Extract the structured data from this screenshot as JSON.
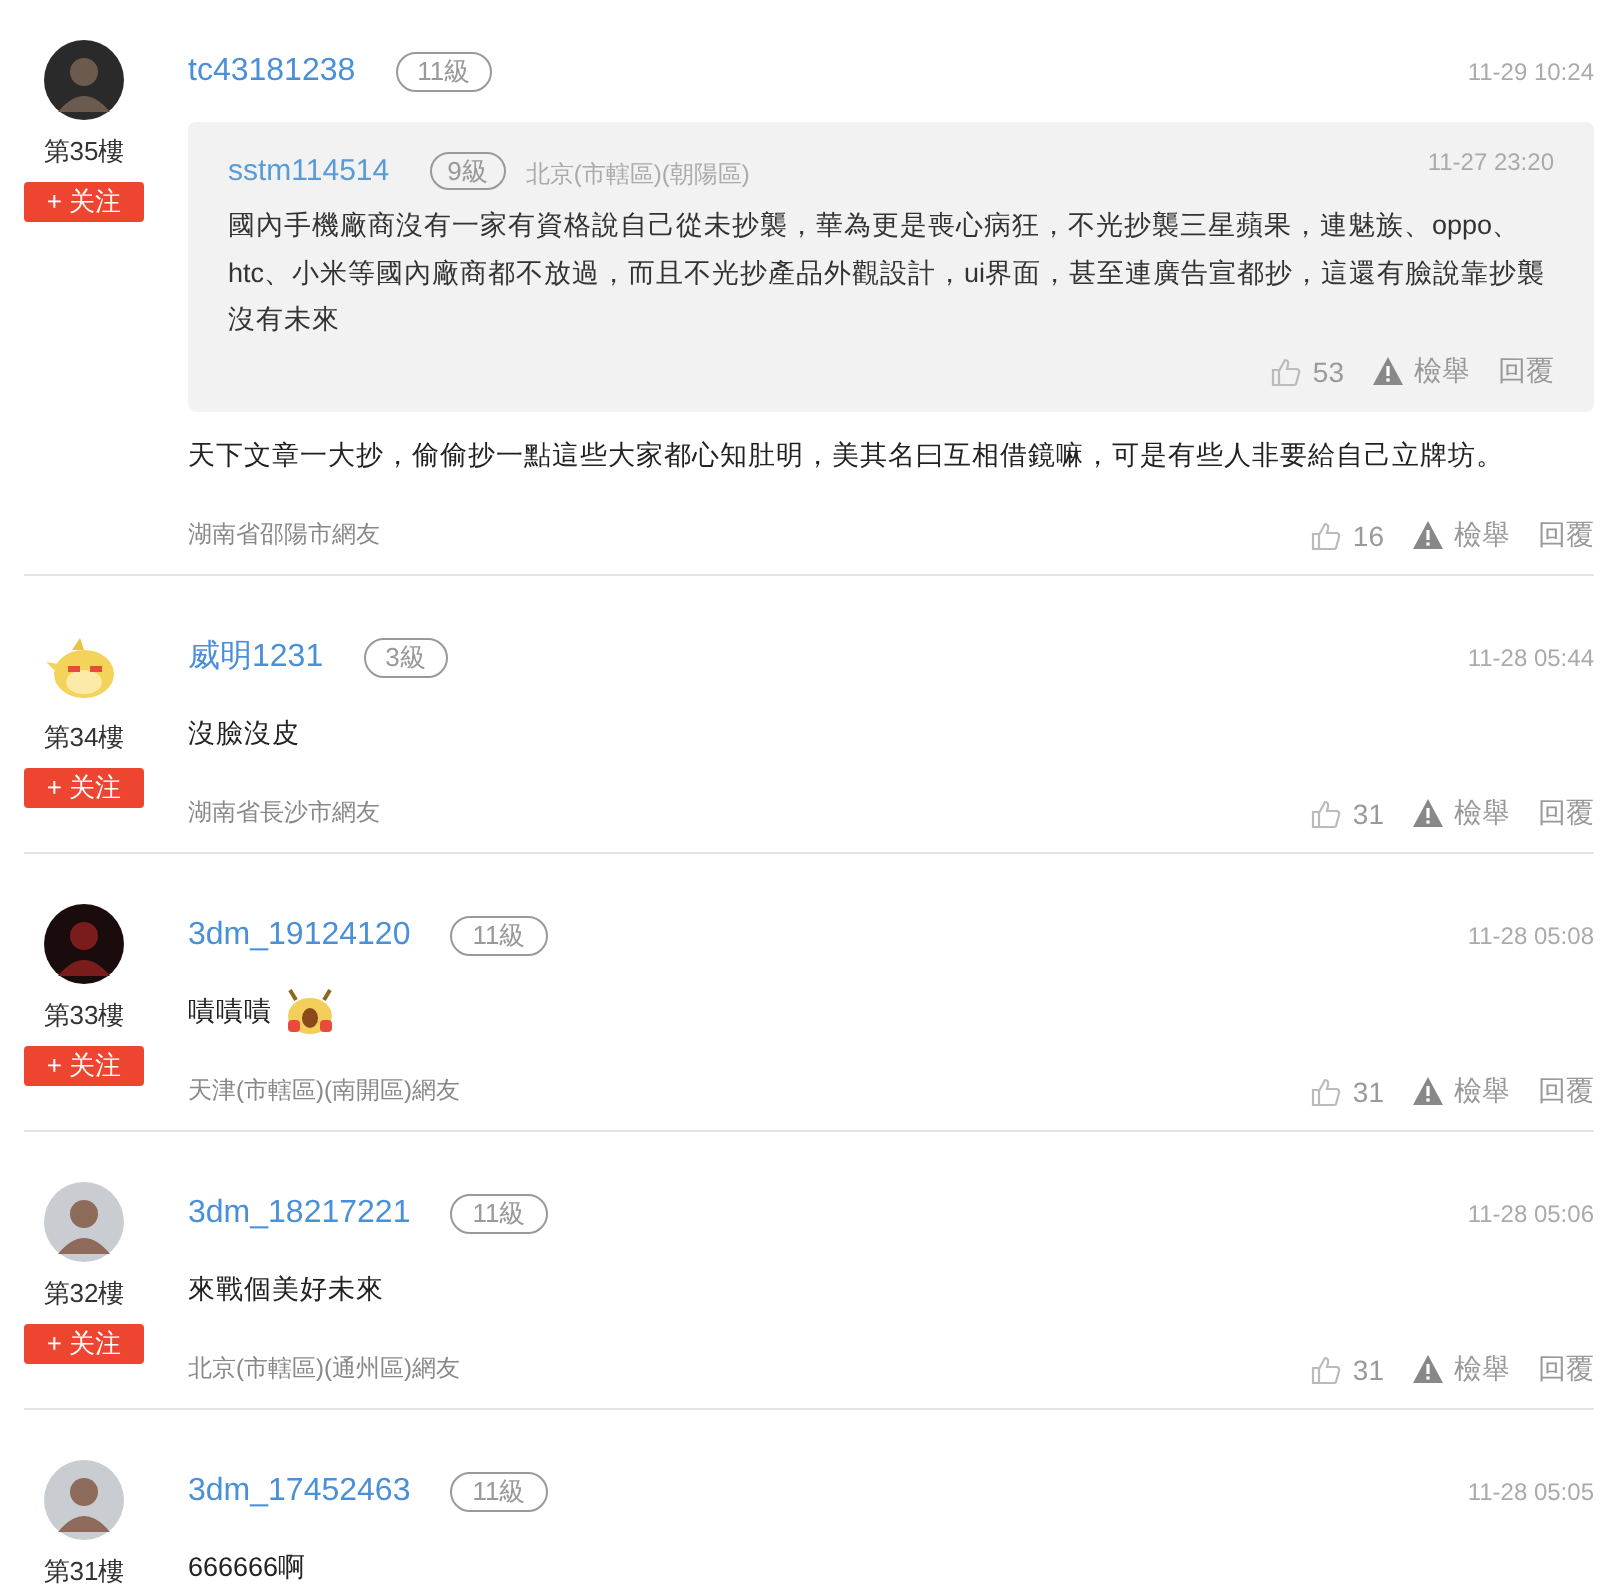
{
  "comments": [
    {
      "avatar": {
        "kind": "dark"
      },
      "floor": "第35樓",
      "follow_button": "+ 关注",
      "username": "tc43181238",
      "level_badge": "11級",
      "time": "11-29 10:24",
      "quote": {
        "username": "sstm114514",
        "level_badge": "9級",
        "location": "北京(市轄區)(朝陽區)",
        "time": "11-27 23:20",
        "text": "國內手機廠商沒有一家有資格說自己從未抄襲，華為更是喪心病狂，不光抄襲三星蘋果，連魅族、oppo、htc、小米等國內廠商都不放過，而且不光抄產品外觀設計，ui界面，甚至連廣告宣都抄，這還有臉說靠抄襲沒有未來",
        "likes": "53",
        "report": "檢舉",
        "reply": "回覆"
      },
      "text": "天下文章一大抄，偷偷抄一點這些大家都心知肚明，美其名曰互相借鏡嘛，可是有些人非要給自己立牌坊。",
      "sticker": false,
      "location": "湖南省邵陽市網友",
      "likes": "16",
      "report": "檢舉",
      "reply": "回覆"
    },
    {
      "avatar": {
        "kind": "chick"
      },
      "floor": "第34樓",
      "follow_button": "+ 关注",
      "username": "威明1231",
      "level_badge": "3級",
      "time": "11-28 05:44",
      "text": "沒臉沒皮",
      "sticker": false,
      "location": "湖南省長沙市網友",
      "likes": "31",
      "report": "檢舉",
      "reply": "回覆"
    },
    {
      "avatar": {
        "kind": "red"
      },
      "floor": "第33樓",
      "follow_button": "+ 关注",
      "username": "3dm_19124120",
      "level_badge": "11級",
      "time": "11-28 05:08",
      "text": "嘖嘖嘖",
      "sticker": true,
      "location": "天津(市轄區)(南開區)網友",
      "likes": "31",
      "report": "檢舉",
      "reply": "回覆"
    },
    {
      "avatar": {
        "kind": "light"
      },
      "floor": "第32樓",
      "follow_button": "+ 关注",
      "username": "3dm_18217221",
      "level_badge": "11級",
      "time": "11-28 05:06",
      "text": "來戰個美好未來",
      "sticker": false,
      "location": "北京(市轄區)(通州區)網友",
      "likes": "31",
      "report": "檢舉",
      "reply": "回覆"
    },
    {
      "avatar": {
        "kind": "light"
      },
      "floor": "第31樓",
      "username": "3dm_17452463",
      "level_badge": "11級",
      "time": "11-28 05:05",
      "text": "666666啊",
      "sticker": false
    }
  ]
}
